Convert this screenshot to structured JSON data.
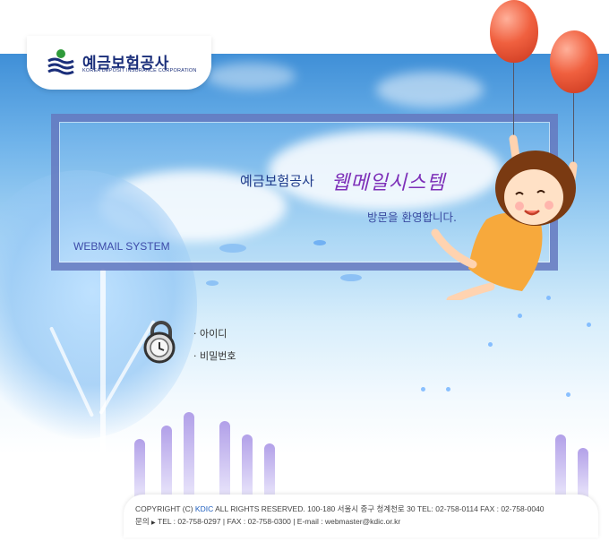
{
  "logo": {
    "name_ko": "예금보험공사",
    "name_en": "KOREA DEPOSIT INSURANCE CORPORATION"
  },
  "banner": {
    "company": "예금보험공사",
    "system_name": "웹메일시스템",
    "welcome": "방문을 환영합니다.",
    "system_en": "WEBMAIL  SYSTEM"
  },
  "login": {
    "id_label": "· 아이디",
    "password_label": "· 비밀번호"
  },
  "footer": {
    "copyright_prefix": "COPYRIGHT (C) ",
    "brand": "KDIC",
    "copyright_suffix": " ALL RIGHTS RESERVED.  100-180 서울시 중구 청계천로 30  TEL: 02-758-0114  FAX : 02-758-0040",
    "contact_label": "문의",
    "contact_arrow": "▶",
    "contact_text": " TEL : 02-758-0297  |  FAX : 02-758-0300  |  E-mail : webmaster@kdic.or.kr"
  },
  "colors": {
    "brand_navy": "#1a2e7a",
    "frame": "#6478be",
    "script_purple": "#7d2fb8",
    "balloon": "#f0603f"
  }
}
